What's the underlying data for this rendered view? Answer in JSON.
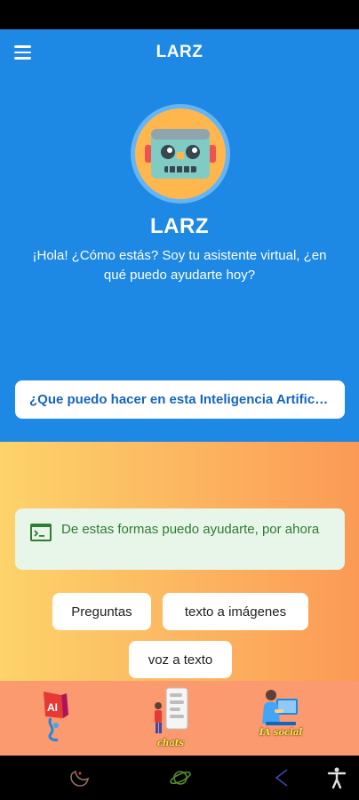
{
  "app_bar": {
    "title": "LARZ"
  },
  "bot": {
    "name": "LARZ",
    "greeting": "¡Hola! ¿Cómo estás? Soy tu asistente virtual, ¿en qué puedo ayudarte hoy?"
  },
  "cta": {
    "label": "¿Que puedo hacer en esta Inteligencia Artificial?"
  },
  "info": {
    "text": "De estas formas puedo ayudarte, por ahora"
  },
  "chips": [
    {
      "label": "Preguntas"
    },
    {
      "label": "texto a imágenes"
    },
    {
      "label": "voz a texto"
    }
  ],
  "bottom_nav": [
    {
      "icon": "ai-figure-icon",
      "caption": ""
    },
    {
      "icon": "chats-figure-icon",
      "caption": "chats"
    },
    {
      "icon": "ia-social-figure-icon",
      "caption": "IA social"
    }
  ],
  "system_nav": [
    "moon-icon",
    "planet-icon",
    "share-icon",
    "accessibility-icon"
  ],
  "colors": {
    "primary": "#1e88e5",
    "gradient_start": "#fdd36a",
    "gradient_end": "#fb9a55",
    "nav_bg": "#fb9a6e",
    "info_bg": "#e8f5e9",
    "info_text": "#2e7d32"
  }
}
